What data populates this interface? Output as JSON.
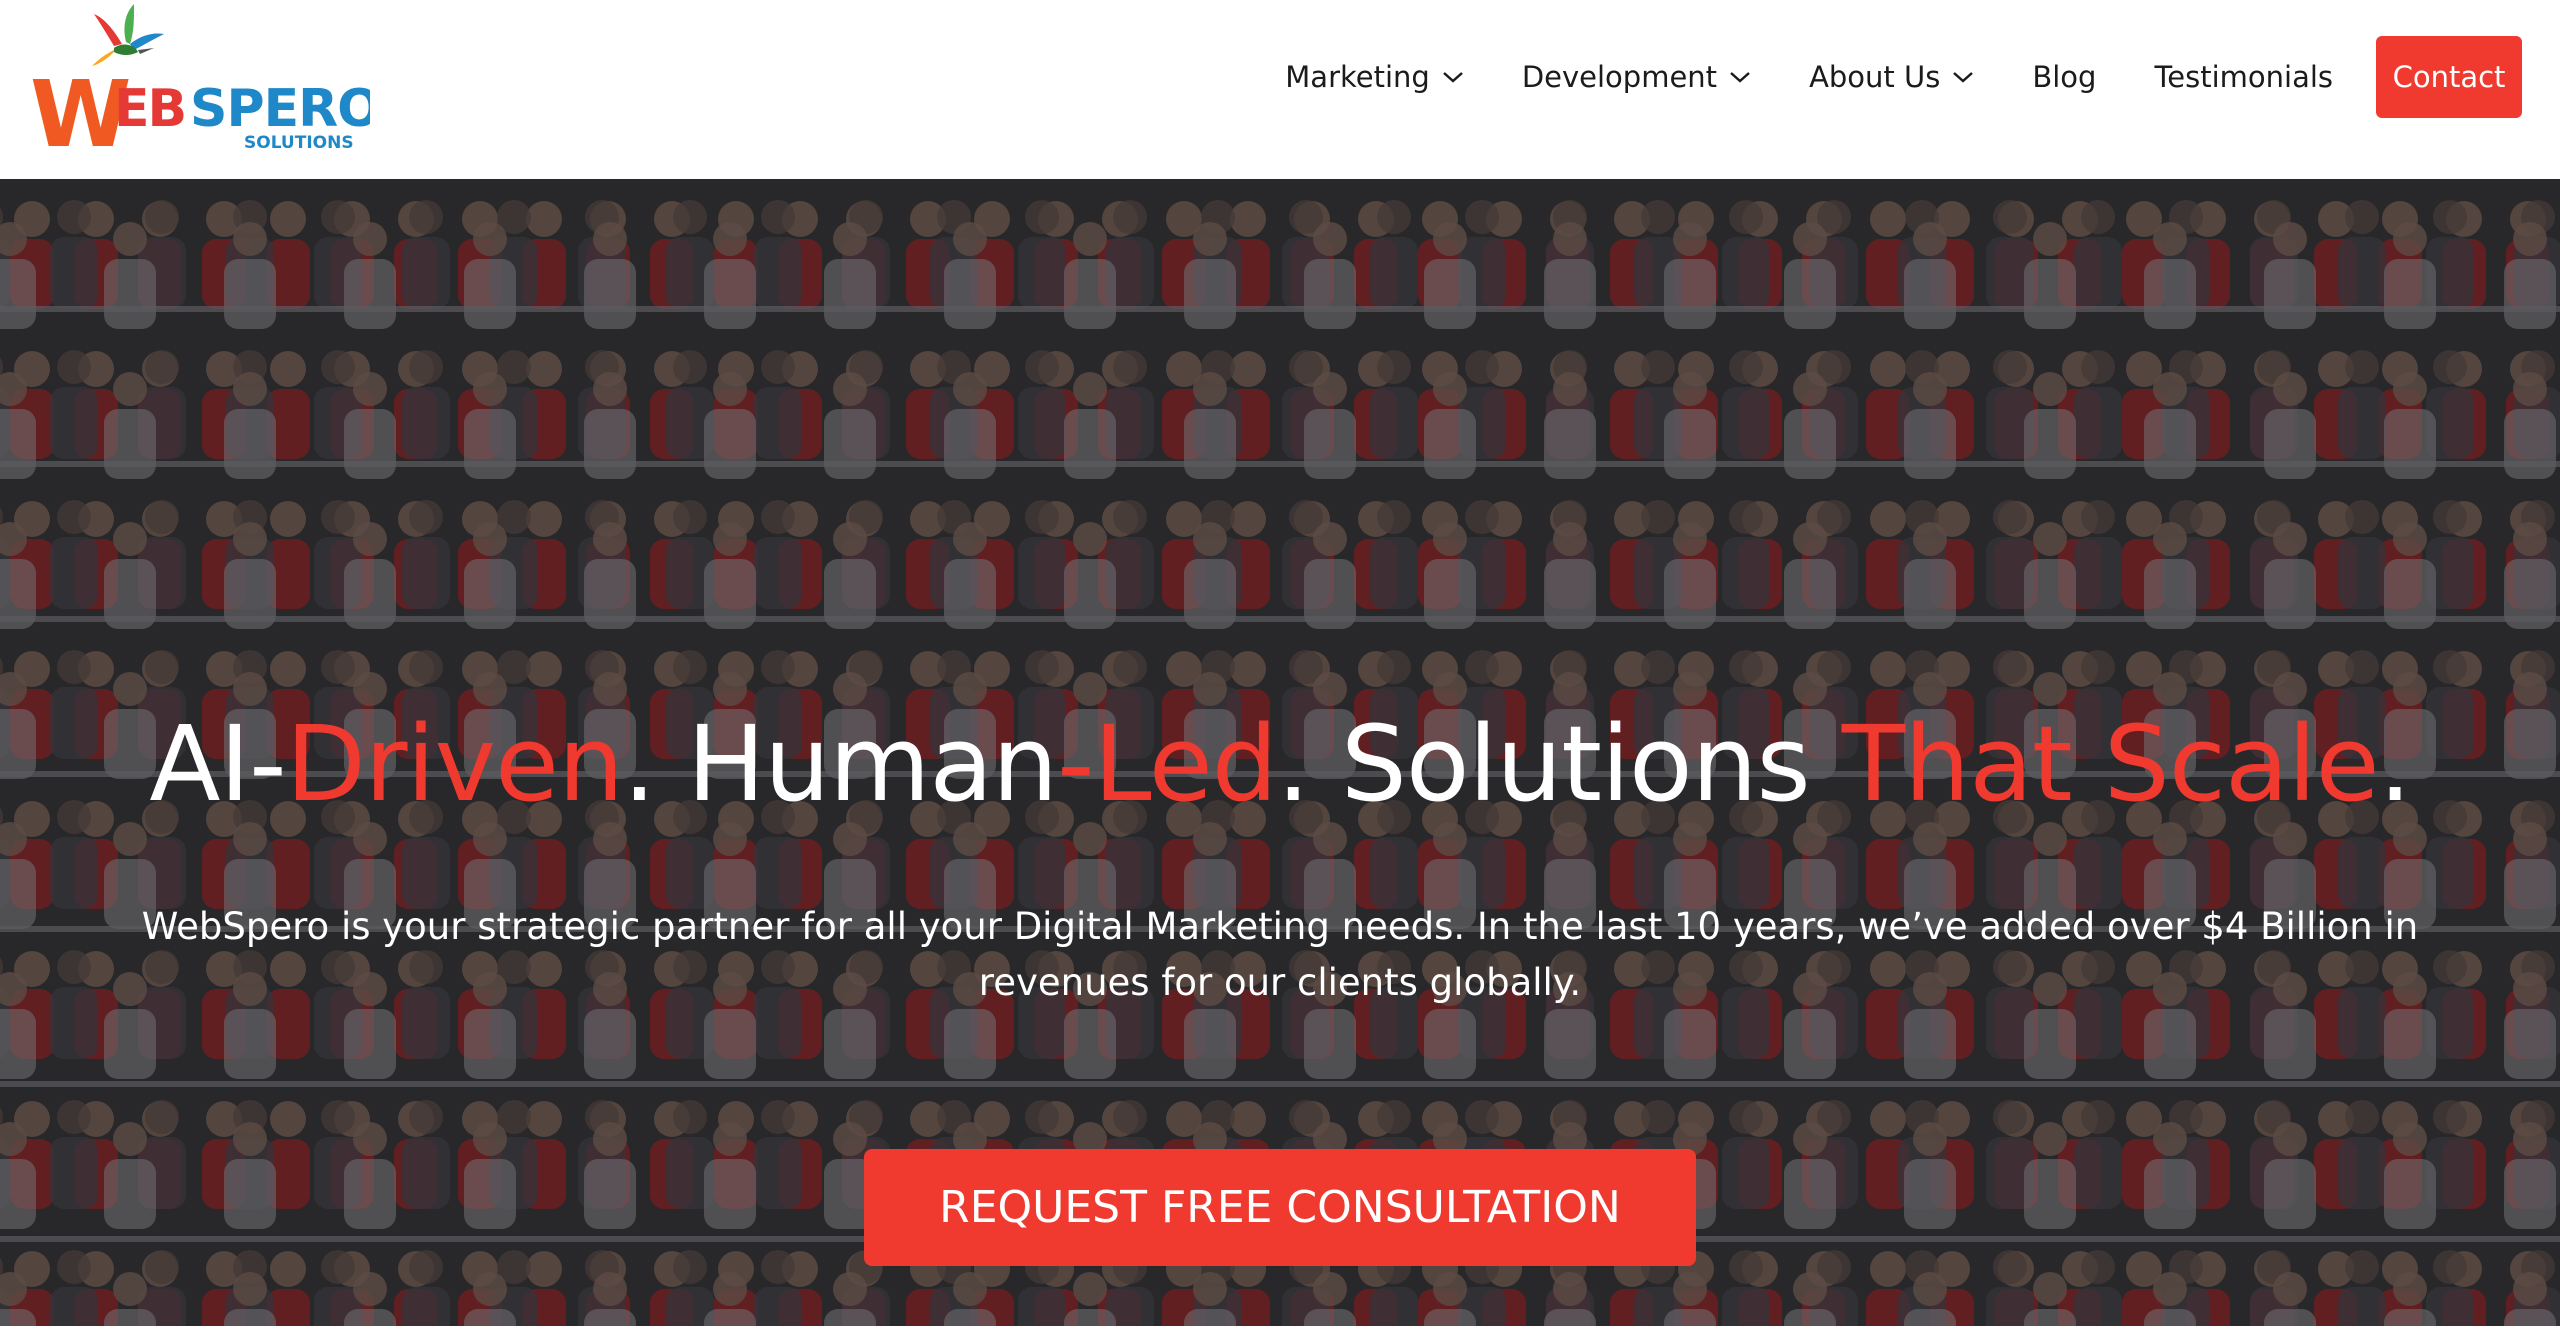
{
  "brand": {
    "logo_text_w": "W",
    "logo_text_main": "EBSPERO",
    "logo_subtext": "SOLUTIONS",
    "logo_colors": {
      "orange": "#f05a22",
      "blue": "#1e88c8",
      "green": "#4caf50",
      "red": "#e53935"
    }
  },
  "nav": {
    "items": [
      {
        "label": "Marketing",
        "has_dropdown": true,
        "icon": "chevron-down-icon"
      },
      {
        "label": "Development",
        "has_dropdown": true,
        "icon": "chevron-down-icon"
      },
      {
        "label": "About Us",
        "has_dropdown": true,
        "icon": "chevron-down-icon"
      },
      {
        "label": "Blog",
        "has_dropdown": false
      },
      {
        "label": "Testimonials",
        "has_dropdown": false
      }
    ],
    "contact_label": "Contact"
  },
  "hero": {
    "headline_parts": {
      "p1": "AI-",
      "p2": "Driven",
      "p3": ". Human",
      "p4": "-Led",
      "p5": ". Solutions ",
      "p6": "That Scale",
      "p7": "."
    },
    "subtext": "WebSpero is your strategic partner for all your Digital Marketing needs. In the last 10 years, we’ve added over $4 Billion in revenues for our clients globally.",
    "cta_label": "REQUEST FREE CONSULTATION",
    "background": "stadium-crowd-photo"
  },
  "colors": {
    "accent": "#f03a2f",
    "nav_text": "#1b1b1b",
    "hero_text": "#ffffff"
  }
}
